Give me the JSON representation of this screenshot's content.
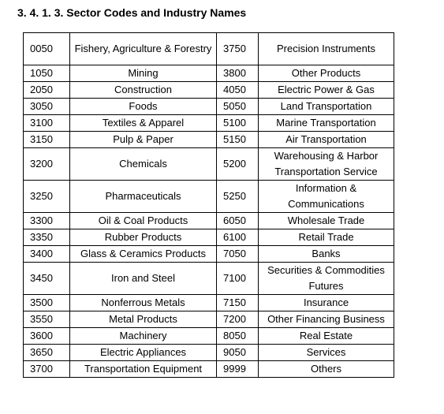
{
  "title": "3. 4. 1. 3. Sector Codes and Industry Names",
  "rows": [
    {
      "code1": "0050",
      "name1": "Fishery, Agriculture & Forestry",
      "code2": "3750",
      "name2": "Precision Instruments"
    },
    {
      "code1": "1050",
      "name1": "Mining",
      "code2": "3800",
      "name2": "Other Products"
    },
    {
      "code1": "2050",
      "name1": "Construction",
      "code2": "4050",
      "name2": "Electric Power & Gas"
    },
    {
      "code1": "3050",
      "name1": "Foods",
      "code2": "5050",
      "name2": "Land Transportation"
    },
    {
      "code1": "3100",
      "name1": "Textiles & Apparel",
      "code2": "5100",
      "name2": "Marine Transportation"
    },
    {
      "code1": "3150",
      "name1": "Pulp & Paper",
      "code2": "5150",
      "name2": "Air Transportation"
    },
    {
      "code1": "3200",
      "name1": "Chemicals",
      "code2": "5200",
      "name2": "Warehousing & Harbor Transportation Service"
    },
    {
      "code1": "3250",
      "name1": "Pharmaceuticals",
      "code2": "5250",
      "name2": "Information & Communications"
    },
    {
      "code1": "3300",
      "name1": "Oil & Coal Products",
      "code2": "6050",
      "name2": "Wholesale Trade"
    },
    {
      "code1": "3350",
      "name1": "Rubber Products",
      "code2": "6100",
      "name2": "Retail Trade"
    },
    {
      "code1": "3400",
      "name1": "Glass & Ceramics Products",
      "code2": "7050",
      "name2": "Banks"
    },
    {
      "code1": "3450",
      "name1": "Iron and Steel",
      "code2": "7100",
      "name2": "Securities & Commodities Futures"
    },
    {
      "code1": "3500",
      "name1": "Nonferrous Metals",
      "code2": "7150",
      "name2": "Insurance"
    },
    {
      "code1": "3550",
      "name1": "Metal Products",
      "code2": "7200",
      "name2": "Other Financing Business"
    },
    {
      "code1": "3600",
      "name1": "Machinery",
      "code2": "8050",
      "name2": "Real Estate"
    },
    {
      "code1": "3650",
      "name1": "Electric Appliances",
      "code2": "9050",
      "name2": "Services"
    },
    {
      "code1": "3700",
      "name1": "Transportation Equipment",
      "code2": "9999",
      "name2": "Others"
    }
  ]
}
